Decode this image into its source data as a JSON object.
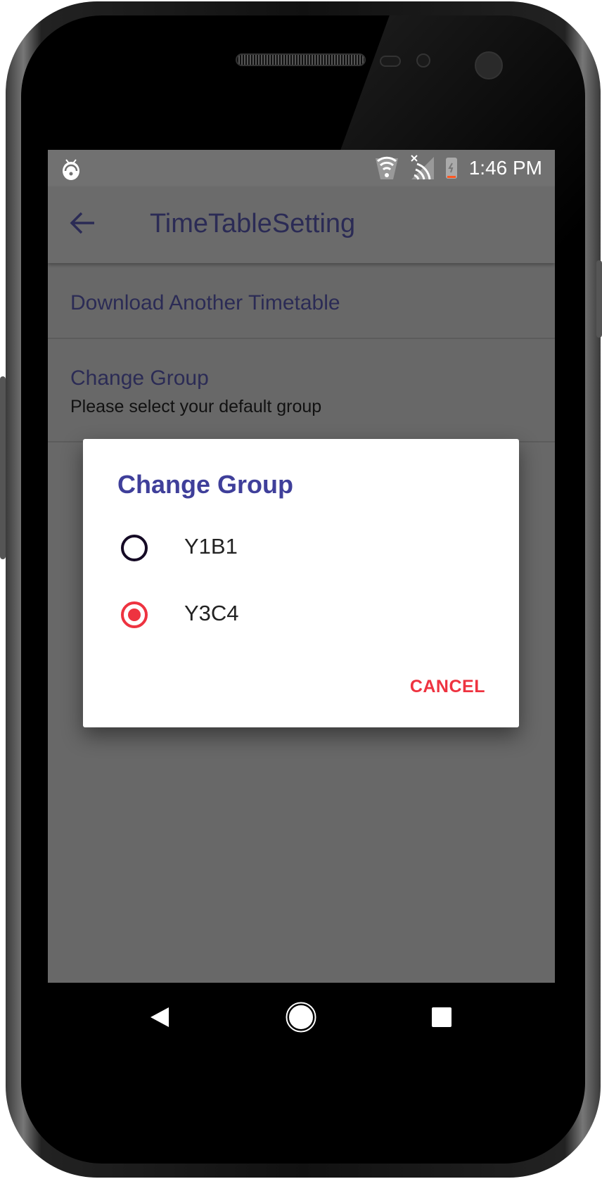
{
  "status_bar": {
    "time": "1:46 PM",
    "icons": [
      "debug-bug-icon",
      "wifi-icon",
      "no-signal-icon",
      "battery-charging-icon"
    ]
  },
  "app_bar": {
    "title": "TimeTableSetting",
    "back_icon": "arrow-left-icon"
  },
  "settings": [
    {
      "title": "Download Another Timetable"
    },
    {
      "title": "Change Group",
      "subtitle": "Please select your default group"
    }
  ],
  "dialog": {
    "title": "Change Group",
    "options": [
      {
        "label": "Y1B1",
        "selected": false
      },
      {
        "label": "Y3C4",
        "selected": true
      }
    ],
    "cancel_label": "CANCEL"
  },
  "colors": {
    "accent": "#ee3340",
    "primary": "#3f3f9a"
  },
  "nav_bar": {
    "icons": [
      "back-triangle-icon",
      "home-circle-icon",
      "recents-square-icon"
    ]
  }
}
